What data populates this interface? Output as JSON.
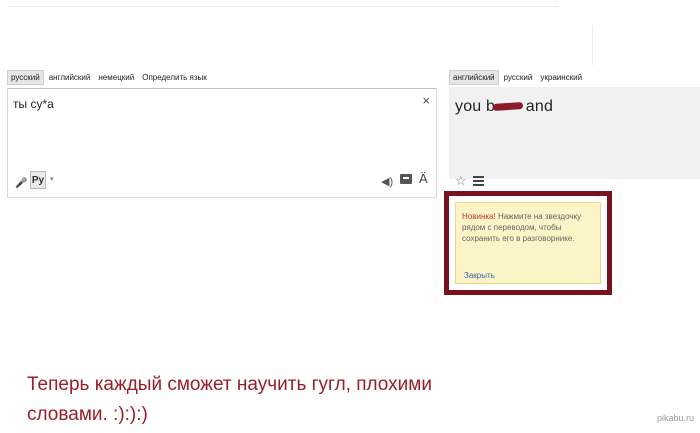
{
  "source_tabs": [
    "русский",
    "английский",
    "немецкий",
    "Определить язык"
  ],
  "target_tabs": [
    "английский",
    "русский",
    "украинский"
  ],
  "source": {
    "text": "ты су*а",
    "clear_symbol": "×",
    "ime_label": "Ру",
    "ime_arrow": "▾",
    "speaker_symbol": "◀)",
    "umlaut_symbol": "Ä"
  },
  "result": {
    "text_before": "you b",
    "text_after": "and",
    "star_symbol": "☆"
  },
  "popup": {
    "new_label": "Новинка!",
    "message": " Нажмите на звездочку рядом с переводом, чтобы сохранить его в разговорнике.",
    "close_label": "Закрыть"
  },
  "caption": "Теперь каждый сможет научить гугл, плохими словами. :):):)",
  "watermark": "pikabu.ru",
  "colors": {
    "caption": "#9c1d2a",
    "frame": "#7a1020",
    "popup_bg": "#fbf4c6",
    "link": "#3b5fb0"
  }
}
